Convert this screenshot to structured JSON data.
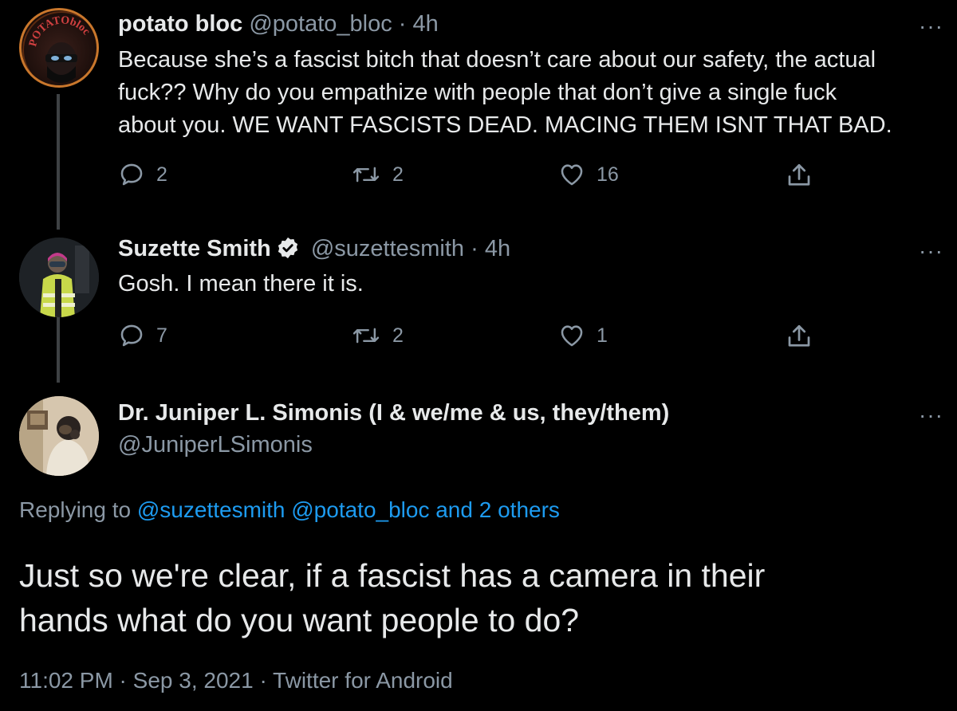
{
  "tweets": [
    {
      "display_name": "potato bloc",
      "handle": "@potato_bloc",
      "time": "4h",
      "avatar_text": "POTATObloc",
      "text_lines": [
        "Because she’s a fascist bitch that doesn’t care about our safety, the actual",
        "fuck?? Why do you empathize with people that don’t give a single fuck",
        "about you. WE WANT FASCISTS DEAD. MACING THEM ISNT THAT BAD."
      ],
      "replies": "2",
      "retweets": "2",
      "likes": "16"
    },
    {
      "display_name": "Suzette Smith",
      "handle": "@suzettesmith",
      "time": "4h",
      "verified": true,
      "text": "Gosh. I mean there it is.",
      "replies": "7",
      "retweets": "2",
      "likes": "1"
    }
  ],
  "main_tweet": {
    "display_name": "Dr. Juniper L. Simonis (I & we/me & us, they/them)",
    "handle": "@JuniperLSimonis",
    "replying_prefix": "Replying to",
    "replying_mentions": "@suzettesmith @potato_bloc and 2 others",
    "text_lines": [
      "Just so we're clear, if a fascist has a camera in their",
      "hands what do you want people to do?"
    ],
    "timestamp": "11:02 PM · Sep 3, 2021 · Twitter for Android"
  },
  "separator": " · ",
  "more_glyph": "···",
  "colors": {
    "background": "#000000",
    "text": "#e7e9ea",
    "secondary": "#8b98a5",
    "link": "#1d9bf0",
    "thread_line": "#3e4144"
  },
  "icons": [
    "reply-icon",
    "retweet-icon",
    "like-icon",
    "share-icon",
    "verified-badge-icon",
    "more-options-icon"
  ]
}
